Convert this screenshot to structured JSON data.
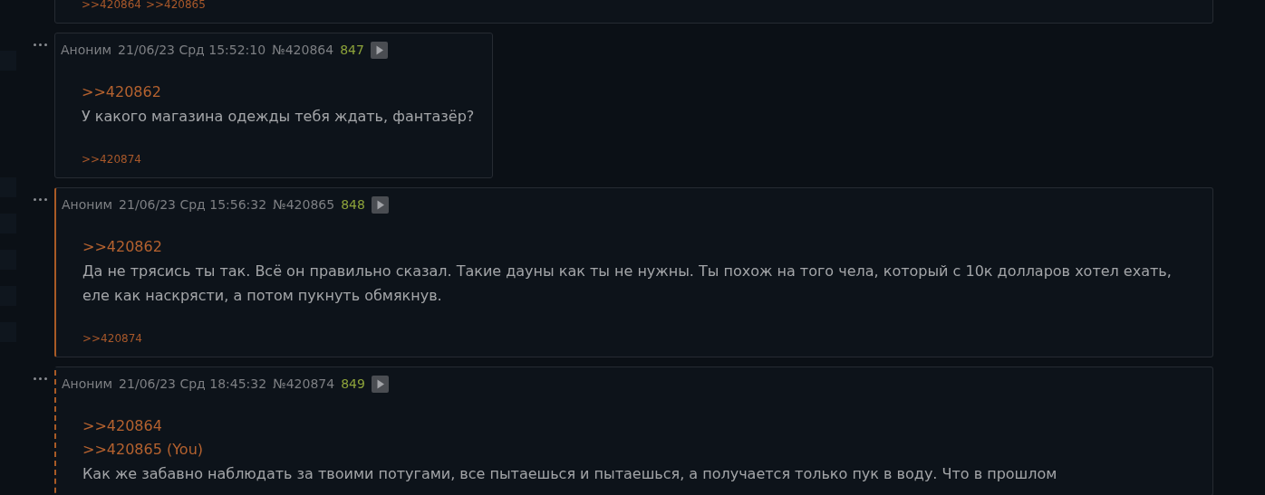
{
  "posts": [
    {
      "kind": "partial",
      "backlinks": [
        ">>420864",
        ">>420865"
      ]
    },
    {
      "kind": "post",
      "name": "Аноним",
      "date": "21/06/23 Срд 15:52:10",
      "number": "№420864",
      "count": "847",
      "own": false,
      "mentions_you": false,
      "quotes": [
        ">>420862"
      ],
      "body": "У какого магазина одежды тебя ждать, фантазёр?",
      "backlinks": [
        ">>420874"
      ]
    },
    {
      "kind": "post",
      "name": "Аноним",
      "date": "21/06/23 Срд 15:56:32",
      "number": "№420865",
      "count": "848",
      "own": true,
      "mentions_you": false,
      "quotes": [
        ">>420862"
      ],
      "body": "Да не трясись ты так. Всё он правильно сказал. Такие дауны как ты не нужны. Ты похож на того чела, который с 10к долларов хотел ехать, еле как наскрясти, а потом пукнуть обмякнув.",
      "backlinks": [
        ">>420874"
      ]
    },
    {
      "kind": "post",
      "name": "Аноним",
      "date": "21/06/23 Срд 18:45:32",
      "number": "№420874",
      "count": "849",
      "own": false,
      "mentions_you": true,
      "quotes": [
        ">>420864",
        ">>420865 (You)"
      ],
      "body": "Как же забавно наблюдать за твоими потугами, все пытаешься и пытаешься, а получается только пук в воду. Что в прошлом"
    }
  ]
}
